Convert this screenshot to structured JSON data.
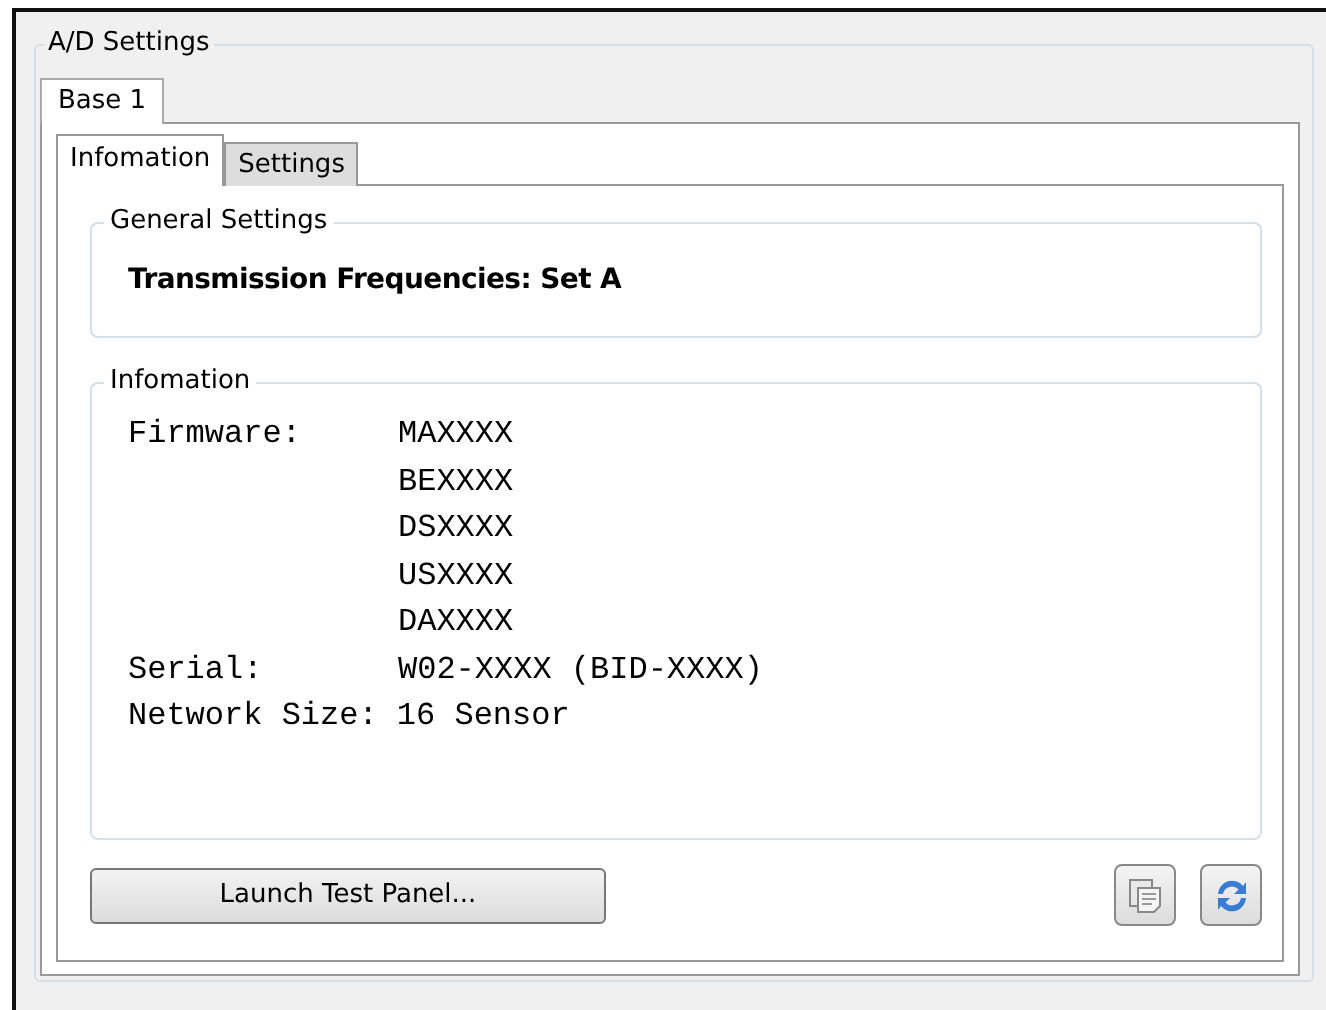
{
  "group_title": "A/D Settings",
  "outer_tabs": [
    {
      "label": "Base 1",
      "selected": true
    }
  ],
  "inner_tabs": [
    {
      "label": "Infomation",
      "selected": true
    },
    {
      "label": "Settings",
      "selected": false
    }
  ],
  "general_settings": {
    "title": "General Settings",
    "text": "Transmission Frequencies: Set A"
  },
  "information": {
    "title": "Infomation",
    "firmware": {
      "label": "Firmware:",
      "values": [
        "MAXXXX",
        "BEXXXX",
        "DSXXXX",
        "USXXXX",
        "DAXXXX"
      ]
    },
    "serial": {
      "label": "Serial:",
      "value": "W02-XXXX (BID-XXXX)"
    },
    "network": "Network Size: 16 Sensor"
  },
  "launch_button": "Launch Test Panel..."
}
